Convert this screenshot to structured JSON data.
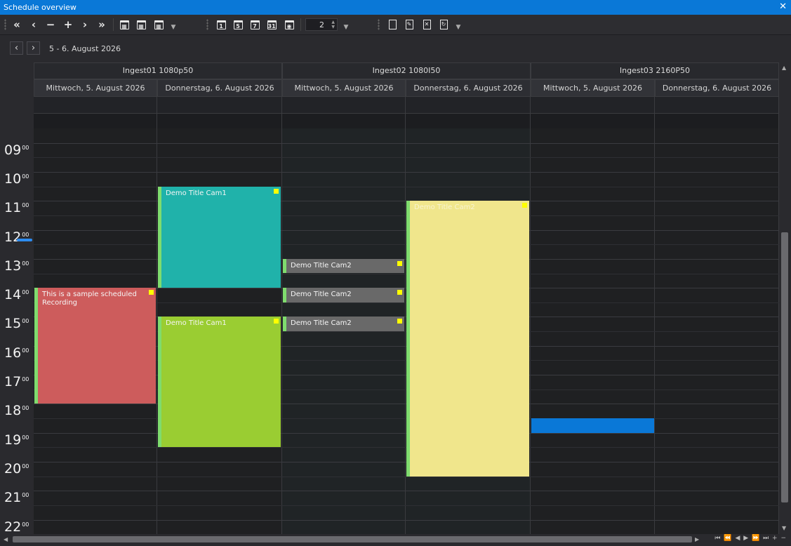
{
  "window": {
    "title": "Schedule overview",
    "close_icon": "close-icon"
  },
  "toolbar": {
    "nav": [
      "«",
      "‹",
      "−",
      "+",
      "›",
      "»"
    ],
    "spinner_value": "2",
    "calendar_icons": [
      "1",
      "5",
      "7",
      "31"
    ]
  },
  "navigation": {
    "date_range": "5 - 6. August 2026"
  },
  "resources": [
    {
      "name": "Ingest01 1080p50"
    },
    {
      "name": "Ingest02 1080I50"
    },
    {
      "name": "Ingest03 2160P50"
    }
  ],
  "days": [
    "Mittwoch, 5. August 2026",
    "Donnerstag, 6. August 2026",
    "Mittwoch, 5. August 2026",
    "Donnerstag, 6. August 2026",
    "Mittwoch, 5. August 2026",
    "Donnerstag, 6. August 2026"
  ],
  "time_minutes_label": "00",
  "hours": [
    "09",
    "10",
    "11",
    "12",
    "13",
    "14",
    "15",
    "16",
    "17",
    "18",
    "19",
    "20",
    "21",
    "22"
  ],
  "appointments": [
    {
      "title": "This is a sample scheduled Recording",
      "resource": "Ingest01 1080p50",
      "day": "Mittwoch, 5. August 2026",
      "start": "14:00",
      "end": "18:00",
      "color": "#cd5c5c"
    },
    {
      "title": "Demo Title Cam1",
      "resource": "Ingest01 1080p50",
      "day": "Donnerstag, 6. August 2026",
      "start": "10:30",
      "end": "14:00",
      "color": "#20b2aa"
    },
    {
      "title": "Demo Title Cam1",
      "resource": "Ingest01 1080p50",
      "day": "Donnerstag, 6. August 2026",
      "start": "15:00",
      "end": "19:30",
      "color": "#9acd32"
    },
    {
      "title": "Demo Title Cam2",
      "resource": "Ingest02 1080I50",
      "day": "Mittwoch, 5. August 2026",
      "start": "13:00",
      "end": "13:30",
      "color": "#696969"
    },
    {
      "title": "Demo Title Cam2",
      "resource": "Ingest02 1080I50",
      "day": "Mittwoch, 5. August 2026",
      "start": "14:00",
      "end": "14:30",
      "color": "#696969"
    },
    {
      "title": "Demo Title Cam2",
      "resource": "Ingest02 1080I50",
      "day": "Mittwoch, 5. August 2026",
      "start": "15:00",
      "end": "15:30",
      "color": "#696969"
    },
    {
      "title": "Demo Title Cam2",
      "resource": "Ingest02 1080I50",
      "day": "Donnerstag, 6. August 2026",
      "start": "11:00",
      "end": "20:30",
      "color": "#f0e68c"
    }
  ],
  "selection": {
    "resource": "Ingest03 2160P50",
    "day": "Mittwoch, 5. August 2026",
    "start": "18:30",
    "end": "19:00",
    "color": "#0a78d7"
  },
  "pager": "⏮ ⏪ ◀ ▶ ⏩ ⏭ + −"
}
